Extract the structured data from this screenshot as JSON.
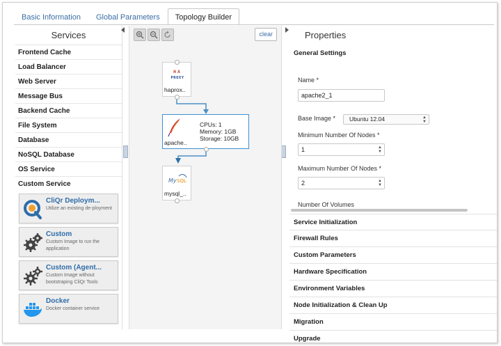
{
  "tabs": [
    {
      "label": "Basic Information"
    },
    {
      "label": "Global Parameters"
    },
    {
      "label": "Topology Builder"
    }
  ],
  "services": {
    "title": "Services",
    "items": [
      {
        "label": "Frontend Cache"
      },
      {
        "label": "Load Balancer"
      },
      {
        "label": "Web Server"
      },
      {
        "label": "Message Bus"
      },
      {
        "label": "Backend Cache"
      },
      {
        "label": "File System"
      },
      {
        "label": "Database"
      },
      {
        "label": "NoSQL Database"
      },
      {
        "label": "OS Service"
      },
      {
        "label": "Custom Service"
      }
    ],
    "cards": [
      {
        "title": "CliQr Deploym...",
        "desc": "Utilize an existing de-ployment",
        "icon": "cliqr-deployment-icon"
      },
      {
        "title": "Custom",
        "desc": "Custom Image to run the application",
        "icon": "gears-icon"
      },
      {
        "title": "Custom (Agent...",
        "desc": "Custom Image without bootstraping CliQr Tools",
        "icon": "gears-icon"
      },
      {
        "title": "Docker",
        "desc": "Docker container service",
        "icon": "docker-icon"
      }
    ]
  },
  "canvas": {
    "clear_label": "clear",
    "tools": [
      "zoom-in-icon",
      "zoom-out-icon",
      "reset-icon"
    ],
    "nodes": {
      "haproxy": {
        "label": "haprox..",
        "logo_text": "HA PROXY"
      },
      "apache": {
        "label": "apache..",
        "cpus": "CPUs: 1",
        "memory": "Memory: 1GB",
        "storage": "Storage: 10GB"
      },
      "mysql": {
        "label": "mysql_..",
        "logo_text": "MySQL"
      }
    }
  },
  "properties": {
    "title": "Properties",
    "general_settings": "General Settings",
    "name_label": "Name *",
    "name_value": "apache2_1",
    "base_image_label": "Base Image *",
    "base_image_value": "Ubuntu 12.04",
    "min_nodes_label": "Minimum Number Of Nodes *",
    "min_nodes_value": "1",
    "max_nodes_label": "Maximum Number Of Nodes *",
    "max_nodes_value": "2",
    "volumes_label": "Number Of Volumes",
    "sections": [
      "Service Initialization",
      "Firewall Rules",
      "Custom Parameters",
      "Hardware Specification",
      "Environment Variables",
      "Node Initialization & Clean Up",
      "Migration",
      "Upgrade"
    ]
  },
  "colors": {
    "link": "#3a6ea5",
    "selected_border": "#3d8fd1",
    "connector": "#4a90c8",
    "card_bg": "#eeeeee"
  }
}
